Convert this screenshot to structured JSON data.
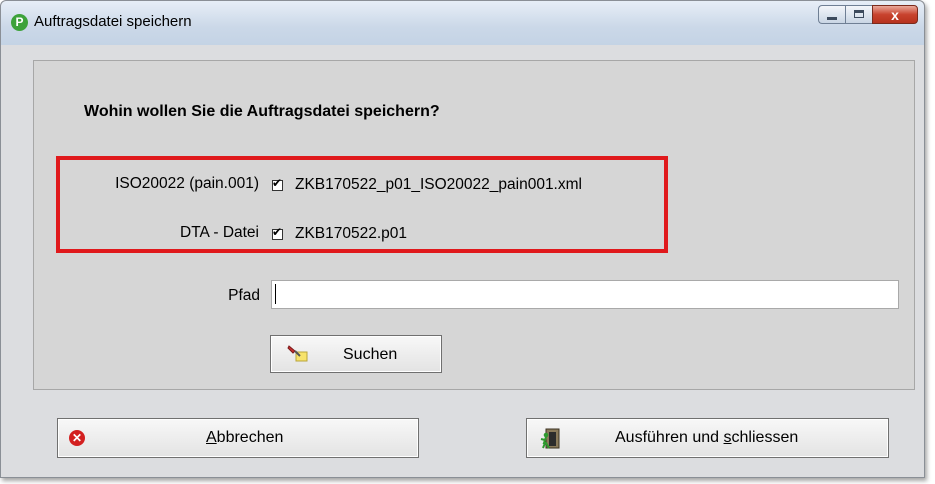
{
  "window": {
    "title": "Auftragsdatei speichern",
    "app_icon_glyph": "P",
    "close_glyph": "x"
  },
  "dialog": {
    "question": "Wohin wollen Sie die Auftragsdatei speichern?",
    "iso": {
      "label": "ISO20022 (pain.001)",
      "checked": true,
      "filename": "ZKB170522_p01_ISO20022_pain001.xml"
    },
    "dta": {
      "label": "DTA - Datei",
      "checked": true,
      "filename": "ZKB170522.p01"
    },
    "path": {
      "label": "Pfad",
      "value": ""
    },
    "search_button": {
      "label": "Suchen",
      "icon": "brush-icon"
    }
  },
  "buttons": {
    "cancel": {
      "pre": "",
      "mnemonic": "A",
      "post": "bbrechen",
      "icon": "cancel-icon"
    },
    "execute": {
      "pre": "Ausführen und ",
      "mnemonic": "s",
      "post": "chliessen",
      "icon": "exit-door-icon"
    }
  },
  "colors": {
    "highlight_border": "#e0191c",
    "panel_bg": "#d6d6d6",
    "window_bg": "#dcdde0"
  }
}
